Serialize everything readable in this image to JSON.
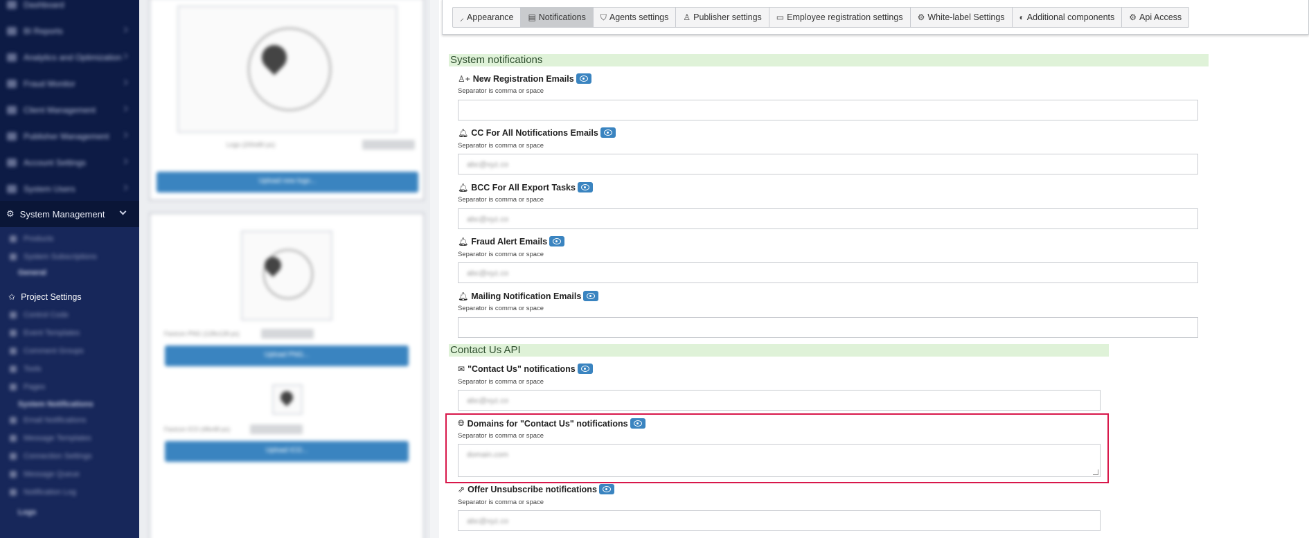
{
  "sidebar": {
    "top_items": [
      "Dashboard",
      "BI Reports",
      "Analytics and Optimization",
      "Fraud Monitor",
      "Client Management",
      "Publisher Management",
      "Account Settings",
      "System Users"
    ],
    "active_section": "System Management",
    "sub_items_a": [
      "Products",
      "System Subscriptions"
    ],
    "group_general": "General",
    "project_settings": "Project Settings",
    "sub_items_b": [
      "Control Code",
      "Event Templates",
      "Comment Groups",
      "Tools",
      "Pages"
    ],
    "group_notifications": "System Notifications",
    "sub_items_c": [
      "Email Notifications",
      "Message Templates",
      "Connection Settings",
      "Message Queue",
      "Notification Log"
    ],
    "group_logs": "Logs"
  },
  "middle": {
    "logo_caption": "Logo (200x80 px)",
    "reset_label": "Reset to default",
    "upload_logo": "Upload new logo...",
    "favicon_png_caption": "Favicon PNG (128x128 px)",
    "upload_png": "Upload PNG...",
    "favicon_ico_caption": "Favicon ICO (48x48 px)",
    "upload_ico": "Upload ICO..."
  },
  "tabs": [
    {
      "label": "Appearance",
      "icon": "brush-icon",
      "glyph": "⸝"
    },
    {
      "label": "Notifications",
      "icon": "note-icon",
      "glyph": "▤",
      "active": true
    },
    {
      "label": "Agents settings",
      "icon": "agent-icon",
      "glyph": "⛉"
    },
    {
      "label": "Publisher settings",
      "icon": "person-icon",
      "glyph": "♙"
    },
    {
      "label": "Employee registration settings",
      "icon": "id-card-icon",
      "glyph": "▭"
    },
    {
      "label": "White-label Settings",
      "icon": "gears-icon",
      "glyph": "⚙"
    },
    {
      "label": "Additional components",
      "icon": "toggle-icon",
      "glyph": "◐"
    },
    {
      "label": "Api Access",
      "icon": "gear-icon",
      "glyph": "⚙"
    }
  ],
  "sections": {
    "system_notifications": "System notifications",
    "contact_us_api": "Contact Us API"
  },
  "help_text": "Separator is comma or space",
  "fields": {
    "new_registration": {
      "label": "New Registration Emails",
      "icon": "user-plus-icon",
      "value": ""
    },
    "cc_all": {
      "label": "CC For All Notifications Emails",
      "icon": "bell-icon",
      "value": "abc@xyz.co"
    },
    "bcc_export": {
      "label": "BCC For All Export Tasks",
      "icon": "bell-icon",
      "value": "abc@xyz.co"
    },
    "fraud_alert": {
      "label": "Fraud Alert Emails",
      "icon": "bell-icon",
      "value": "abc@xyz.co"
    },
    "mailing": {
      "label": "Mailing Notification Emails",
      "icon": "bell-icon",
      "value": ""
    },
    "contact_us": {
      "label": "\"Contact Us\" notifications",
      "icon": "envelope-open-icon",
      "value": "abc@xyz.co"
    },
    "domains_contact_us": {
      "label": "Domains for \"Contact Us\" notifications",
      "icon": "globe-icon",
      "value": "domain.com"
    },
    "offer_unsubscribe": {
      "label": "Offer Unsubscribe notifications",
      "icon": "share-icon",
      "value": "abc@xyz.co"
    }
  },
  "colors": {
    "accent": "#3a84c0",
    "sidebar": "#0d1b45",
    "highlight": "#d8174a",
    "section_bg": "#dff2d8"
  }
}
